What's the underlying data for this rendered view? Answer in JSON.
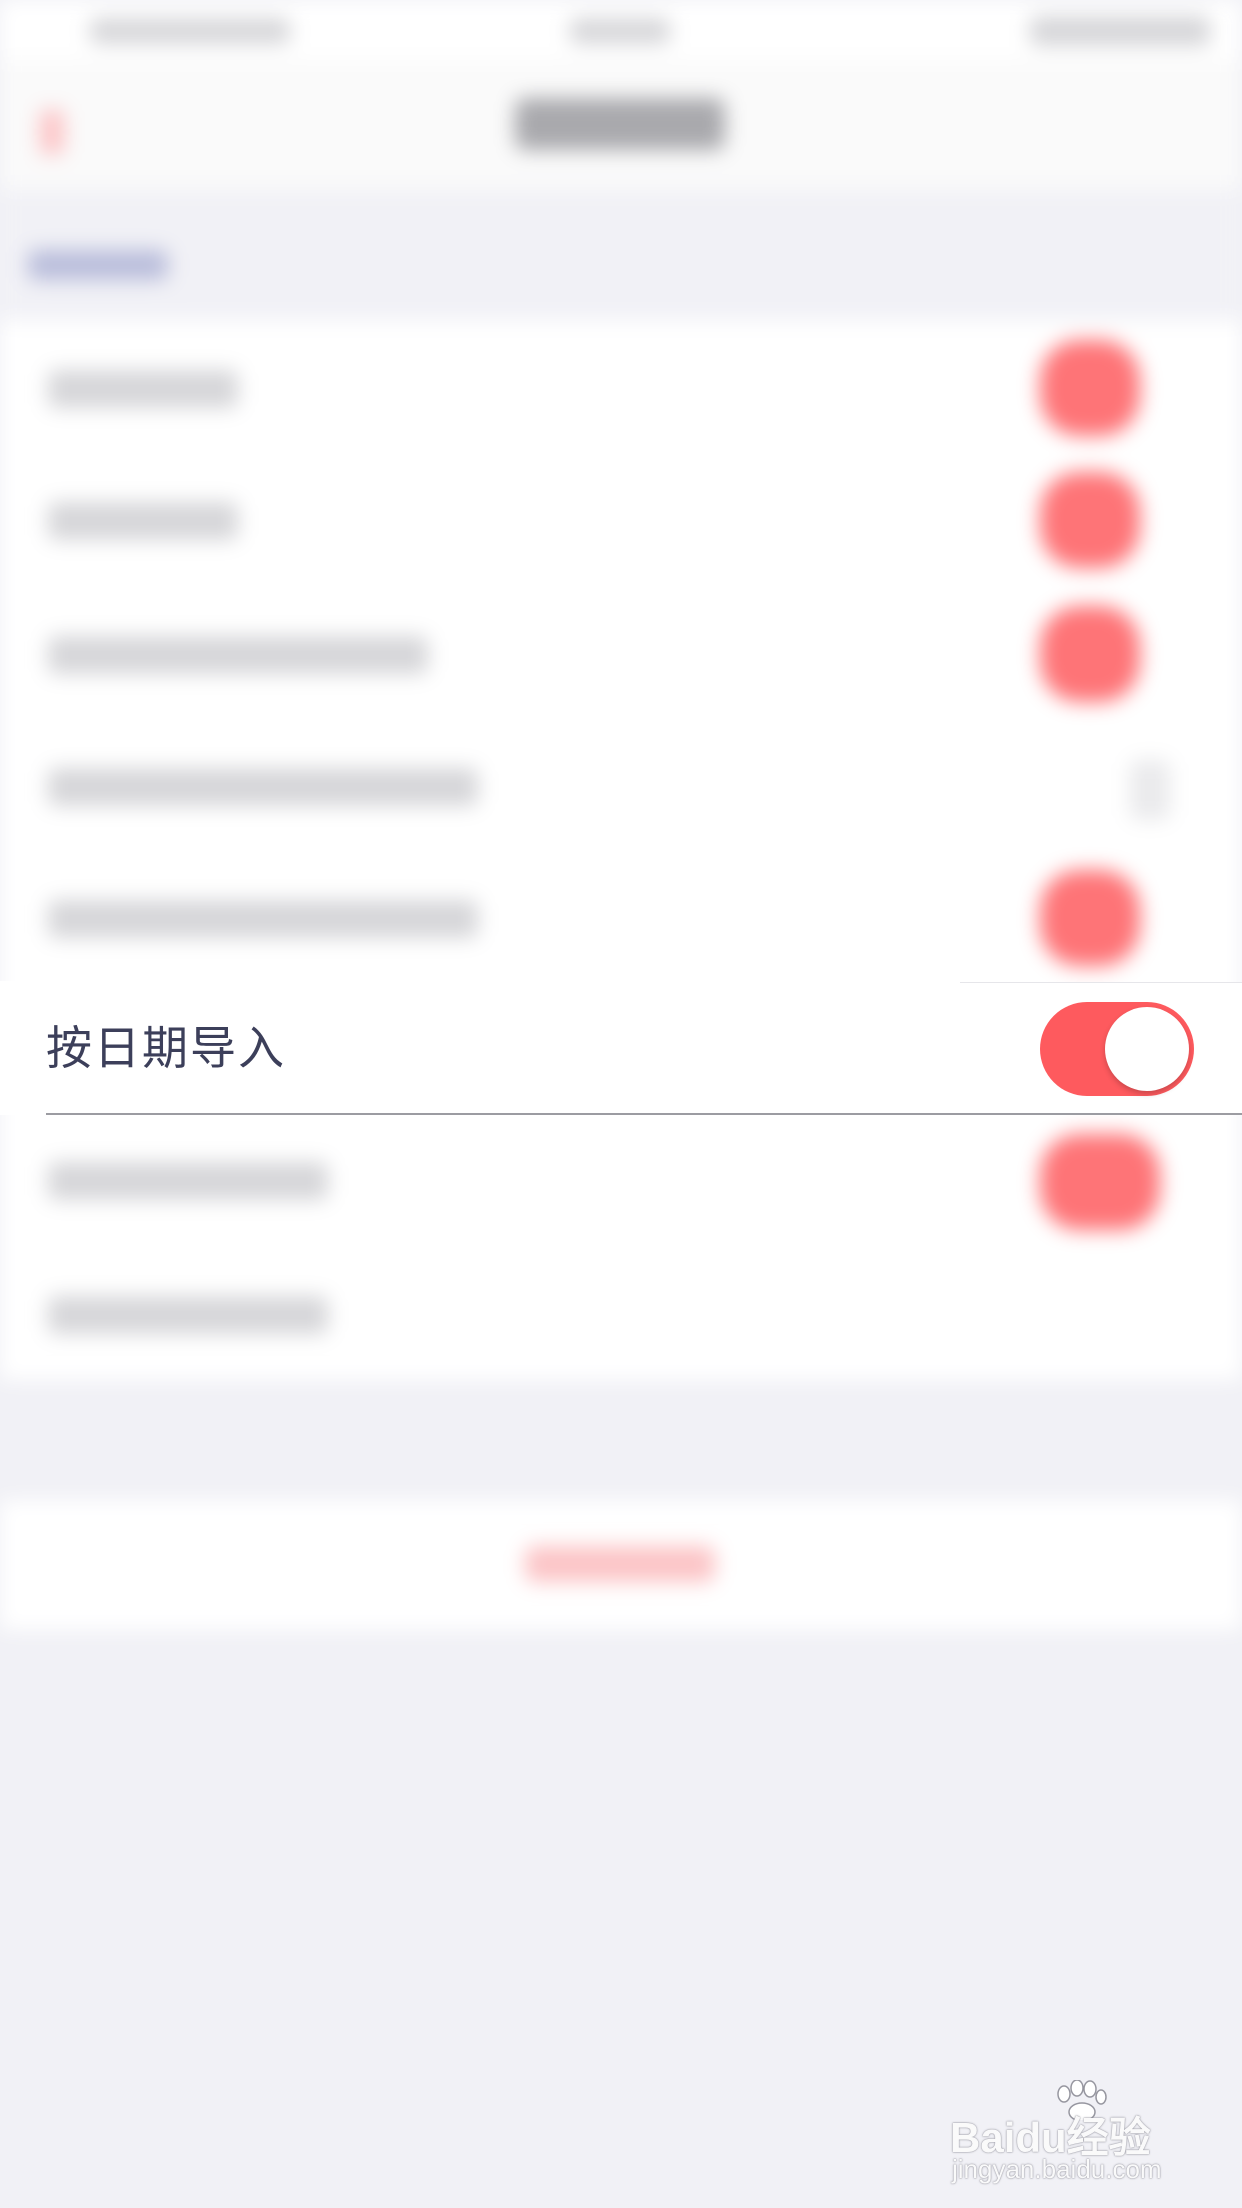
{
  "setting_row": {
    "label": "按日期导入",
    "toggle_on": true
  },
  "colors": {
    "accent": "#fe5a5e",
    "label_text": "#3c3f5a",
    "background": "#f1f1f6"
  },
  "watermark": {
    "brand": "Baidu经验",
    "url": "jingyan.baidu.com"
  }
}
